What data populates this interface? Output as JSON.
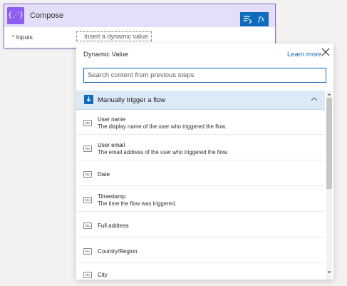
{
  "compose": {
    "title": "Compose",
    "icon": "code-braces-icon",
    "icon_glyph": "{⋰}",
    "inputs_label": "Inputs",
    "required_mark": "*",
    "placeholder": "Insert a dynamic value"
  },
  "toolbar": {
    "dynamic_content_icon": "dynamic-content-icon",
    "expression_label": "fx"
  },
  "panel": {
    "title": "Dynamic Value",
    "learn_more": "Learn more",
    "search_placeholder": "Search content from previous steps",
    "group": {
      "title": "Manually trigger a flow",
      "icon": "manual-trigger-icon",
      "items": [
        {
          "name": "User name",
          "description": "The display name of the user who triggered the flow."
        },
        {
          "name": "User email",
          "description": "The email address of the user who triggered the flow."
        },
        {
          "name": "Date",
          "description": ""
        },
        {
          "name": "Timestamp",
          "description": "The time the flow was triggered."
        },
        {
          "name": "Full address",
          "description": ""
        },
        {
          "name": "Country/Region",
          "description": ""
        },
        {
          "name": "City",
          "description": ""
        }
      ]
    },
    "item_icon_text": "Abc"
  },
  "colors": {
    "accent": "#0f6cbd",
    "compose_header": "#e5defa",
    "compose_icon": "#8b5ff0",
    "group_header": "#dce9f7"
  }
}
